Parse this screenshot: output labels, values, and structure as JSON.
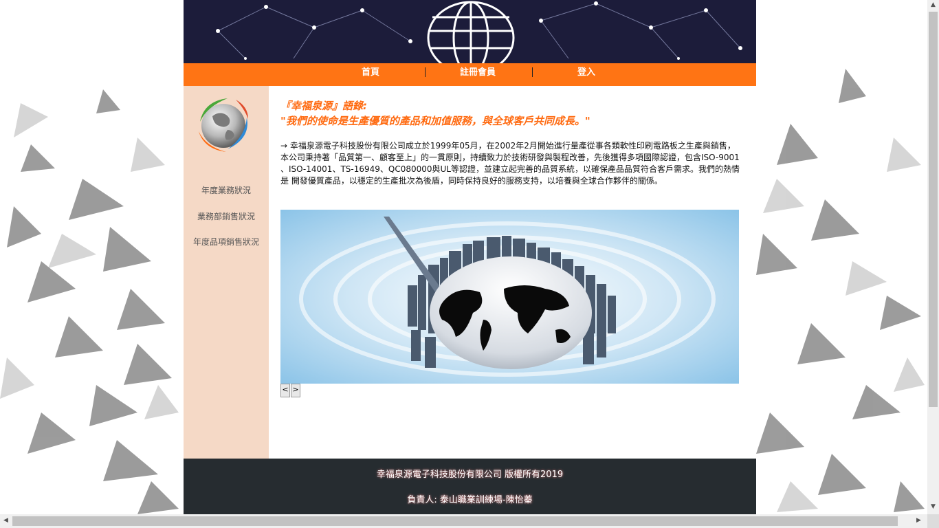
{
  "nav": {
    "items": [
      {
        "label": "首頁"
      },
      {
        "label": "註冊會員"
      },
      {
        "label": "登入"
      }
    ]
  },
  "sidebar": {
    "items": [
      {
        "label": "年度業務狀況"
      },
      {
        "label": "業務部銷售狀況"
      },
      {
        "label": "年度品項銷售狀況"
      }
    ]
  },
  "main": {
    "quote_title": "『幸福泉源』語錄:",
    "quote_text": "\"我們的使命是生產優質的產品和加值服務，與全球客戶共同成長。\"",
    "intro": "→ 幸福泉源電子科技股份有限公司成立於1999年05月，在2002年2月開始進行量產從事各類軟性印刷電路板之生產與銷售， 本公司秉持著「品質第一、顧客至上」的一貫原則，持續致力於技術研發與製程改善，先後獲得多項國際認證，包含ISO-9001 、ISO-14001、TS-16949、QC080000與UL等認證，並建立起完善的品質系統，以確保產品品質符合客戶需求。我們的熱情是 開發優質產品，以穩定的生產批次為後盾，同時保持良好的服務支持，以培養與全球合作夥伴的關係。",
    "prev_label": "<",
    "next_label": ">"
  },
  "footer": {
    "copyright": "幸福泉源電子科技股份有限公司 版權所有2019",
    "contact": "負責人: 泰山職業訓練場-陳怡蓁"
  },
  "colors": {
    "nav_bg": "#ff7414",
    "sidebar_bg": "#f5d9c6",
    "accent_text": "#ff6a10",
    "footer_bg": "#262c30",
    "banner_bg": "#1c1c3a"
  },
  "icons": [
    "globe-logo-icon",
    "city-globe-image",
    "network-globe-banner"
  ]
}
